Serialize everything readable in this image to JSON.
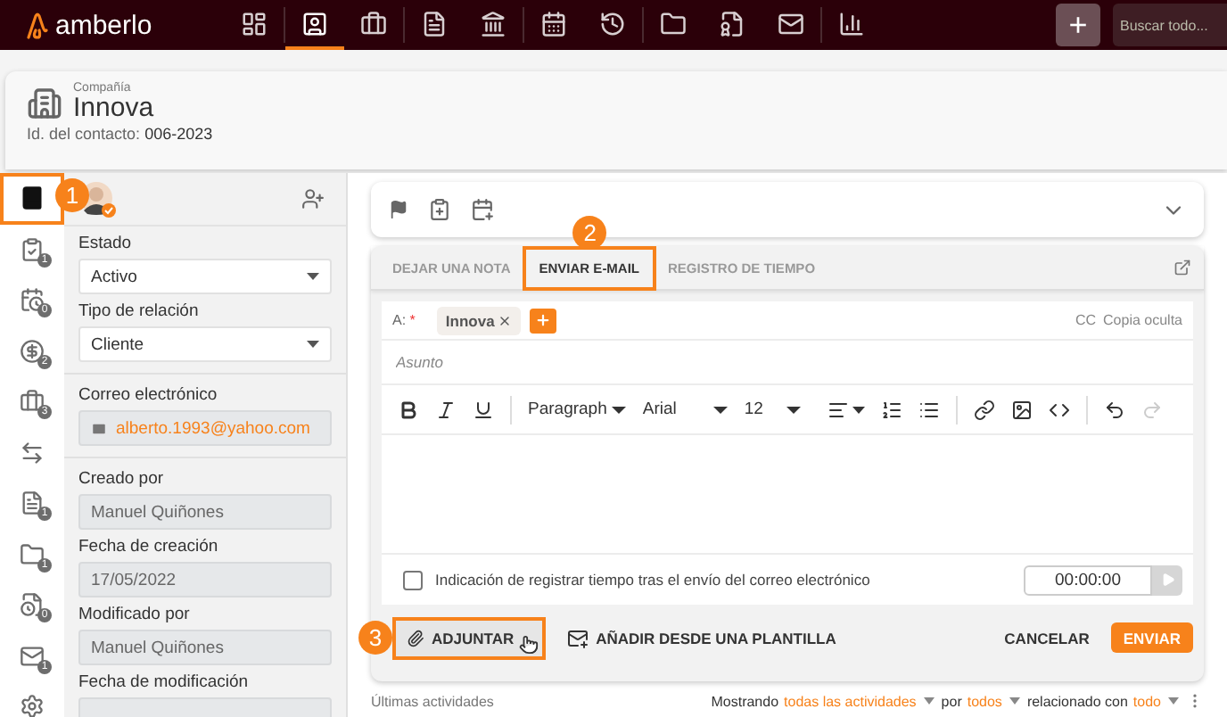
{
  "top_nav": {
    "logo": "amberlo",
    "items": [
      {
        "selected": false
      },
      {
        "selected": true
      },
      {
        "selected": false
      },
      {
        "selected": false
      },
      {
        "selected": false
      },
      {
        "selected": false
      },
      {
        "selected": false
      },
      {
        "selected": false
      },
      {
        "selected": false
      },
      {
        "selected": false
      },
      {
        "selected": false
      }
    ],
    "add_button": "+",
    "search": {
      "placeholder": "Buscar todo..."
    }
  },
  "header": {
    "type_label": "Compañía",
    "name": "Innova",
    "id_label": "Id. del contacto:",
    "id_value": "006-2023"
  },
  "rail": [
    {
      "selected": true,
      "callout": "1"
    },
    {
      "selected": false,
      "count": "1"
    },
    {
      "selected": false,
      "count": "0"
    },
    {
      "selected": false,
      "count": "2"
    },
    {
      "selected": false,
      "count": "3"
    },
    {
      "selected": false
    },
    {
      "selected": false,
      "count": "1"
    },
    {
      "selected": false,
      "count": "1"
    },
    {
      "selected": false,
      "count": "0"
    },
    {
      "selected": false,
      "count": "1"
    },
    {
      "selected": false
    }
  ],
  "left_panel": {
    "selects": [
      {
        "label": "Estado",
        "value": "Activo"
      },
      {
        "label": "Tipo de relación",
        "value": "Cliente"
      }
    ],
    "email": {
      "label": "Correo electrónico",
      "value": "alberto.1993@yahoo.com"
    },
    "readonly_fields": [
      {
        "label": "Creado por",
        "value": "Manuel Quiñones"
      },
      {
        "label": "Fecha de creación",
        "value": "17/05/2022"
      },
      {
        "label": "Modificado por",
        "value": "Manuel Quiñones"
      },
      {
        "label": "Fecha de modificación"
      }
    ]
  },
  "composer": {
    "tabs": [
      {
        "label": "DEJAR UNA NOTA",
        "selected": false
      },
      {
        "label": "ENVIAR E-MAIL",
        "selected": true,
        "callout": "2"
      },
      {
        "label": "REGISTRO DE TIEMPO",
        "selected": false
      }
    ],
    "to_label": "A:",
    "required_mark": "*",
    "recipients": [
      "Innova"
    ],
    "cc": "CC",
    "bcc": "Copia oculta",
    "subject": {
      "placeholder": "Asunto"
    },
    "toolbar": {
      "format": "Paragraph",
      "font": "Arial",
      "size": "12"
    },
    "track_time": {
      "label": "Indicación de registrar tiempo tras el envío del correo electrónico",
      "checked": false
    },
    "timer": "00:00:00",
    "attach": {
      "label": "ADJUNTAR",
      "callout": "3"
    },
    "template": "AÑADIR DESDE UNA PLANTILLA",
    "cancel": "CANCELAR",
    "send": "ENVIAR"
  },
  "activities": {
    "title": "Últimas actividades",
    "prefix": "Mostrando",
    "filter_1": "todas las actividades",
    "by": "por",
    "filter_2": "todos",
    "related": "relacionado con",
    "filter_3": "todo"
  }
}
